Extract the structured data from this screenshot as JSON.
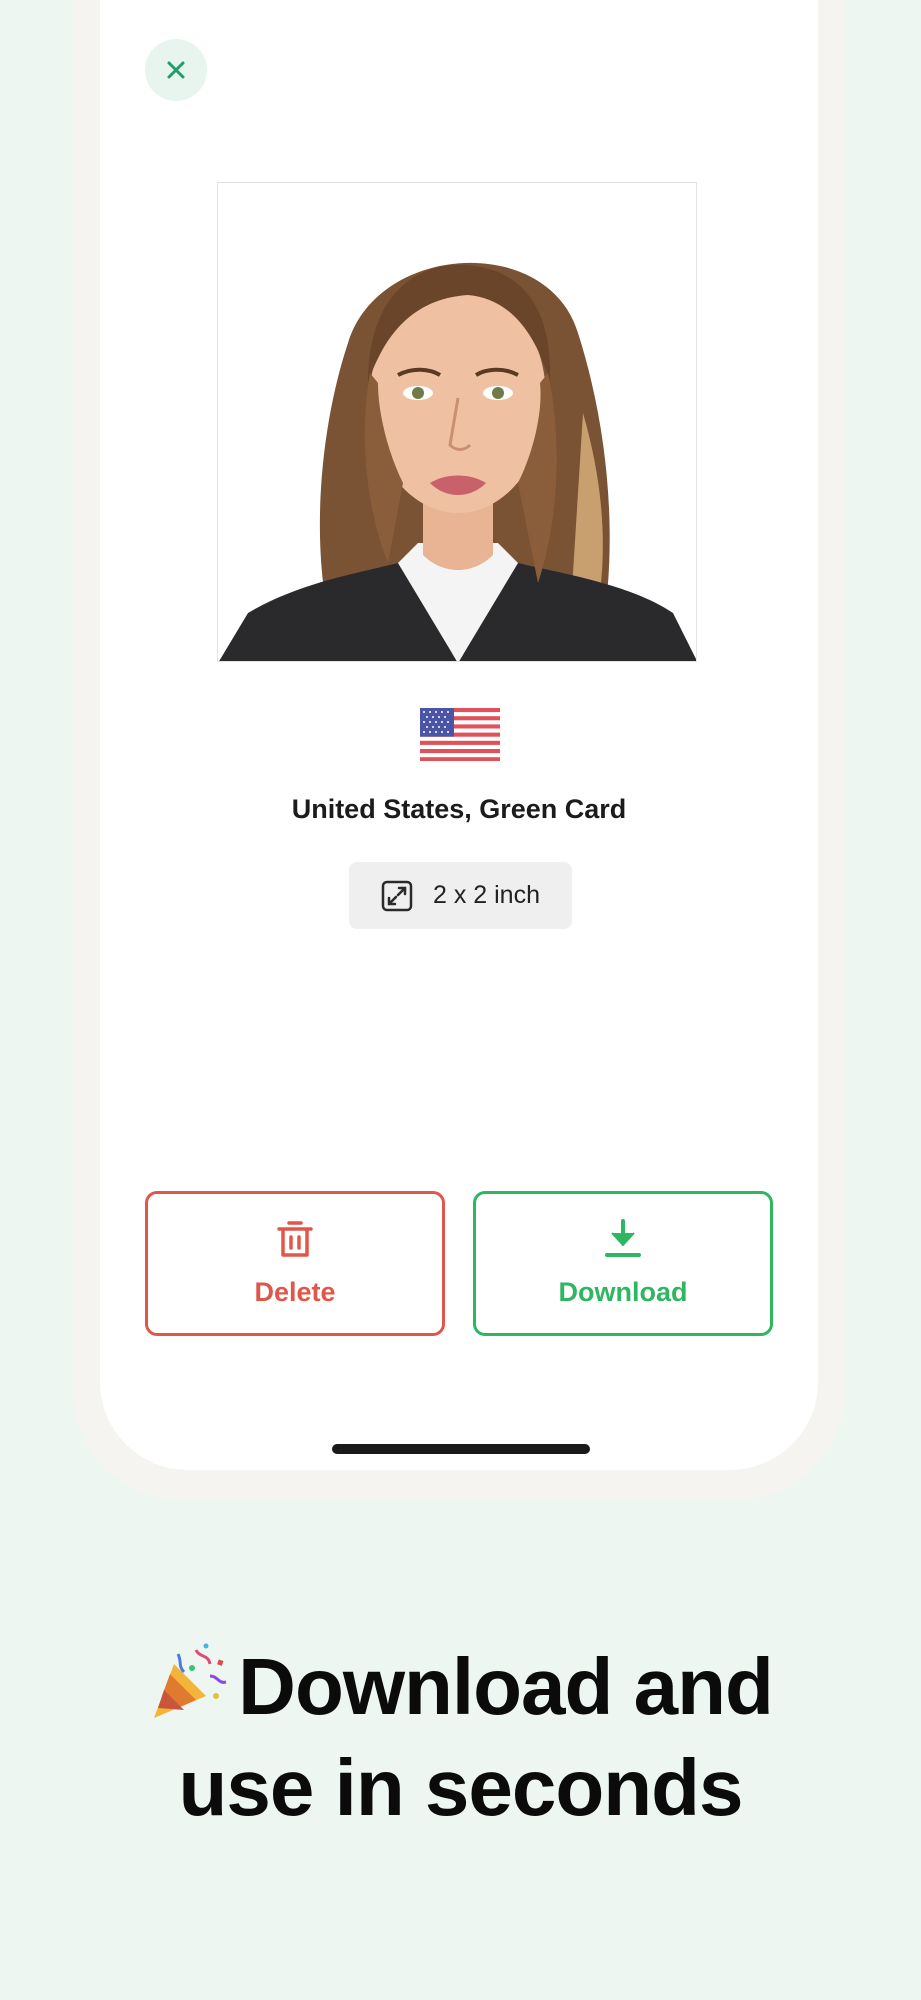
{
  "close": {
    "icon": "close-icon"
  },
  "document": {
    "country_flag": "us-flag",
    "title": "United States, Green Card",
    "size": "2 x 2 inch",
    "size_icon": "resize-icon"
  },
  "actions": {
    "delete_label": "Delete",
    "delete_icon": "trash-icon",
    "download_label": "Download",
    "download_icon": "download-icon"
  },
  "colors": {
    "accent_green": "#2fb661",
    "danger_red": "#e0574a",
    "background": "#eef6f2"
  },
  "headline": {
    "icon": "party-popper-icon",
    "line1": "Download and",
    "line2": "use in seconds"
  }
}
